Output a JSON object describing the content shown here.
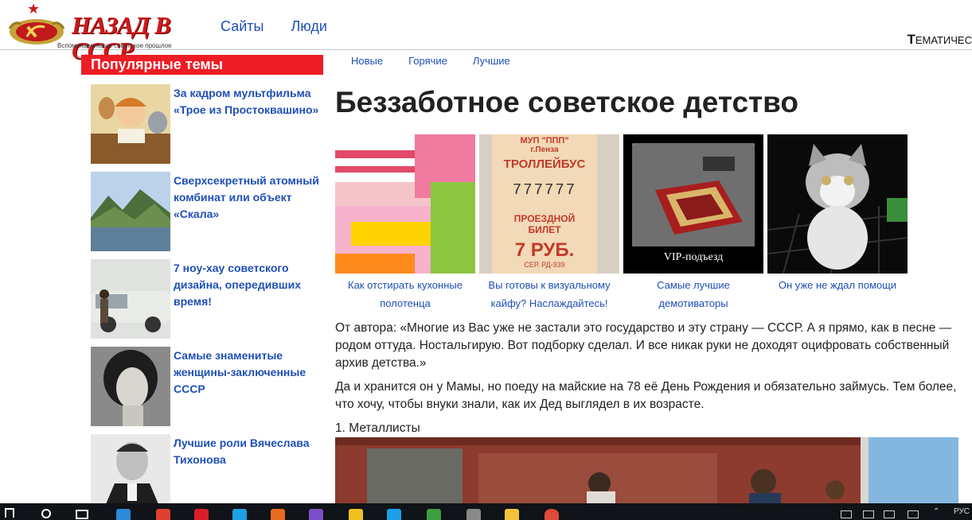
{
  "header": {
    "logo_title": "НАЗАД В СССР",
    "logo_subtitle": "Вспоминаем наше советское прошлое",
    "nav": [
      "Сайты",
      "Люди"
    ],
    "thematic_first": "Т",
    "thematic_rest": "ЕМАТИЧЕС"
  },
  "sidebar": {
    "heading": "Популярные темы",
    "items": [
      {
        "title": "За кадром мультфильма «Трое из Простоквашино»"
      },
      {
        "title": "Сверхсекретный атомный комбинат или объект «Скала»"
      },
      {
        "title": "7 ноу-хау советского дизайна, опередивших время!"
      },
      {
        "title": "Самые знаменитые женщины-заключенные СССР"
      },
      {
        "title": "Лучшие роли Вячеслава Тихонова"
      }
    ]
  },
  "subnav": [
    "Новые",
    "Горячие",
    "Лучшие"
  ],
  "article": {
    "title": "Беззаботное советское детство",
    "gallery": [
      {
        "caption": "Как отстирать кухонные полотенца"
      },
      {
        "caption": "Вы готовы к визуальному кайфу? Наслаждайтесь!",
        "ticket_org": "МУП \"ППП\"",
        "ticket_city": "г.Пенза",
        "ticket_type": "ТРОЛЛЕЙБУС",
        "ticket_number": "777777",
        "ticket_label1": "ПРОЕЗДНОЙ",
        "ticket_label2": "БИЛЕТ",
        "ticket_price": "7 РУБ.",
        "ticket_series": "СЕР. РД-939"
      },
      {
        "caption": "Самые лучшие демотиваторы",
        "image_label": "VIP-подъезд"
      },
      {
        "caption": "Он уже не ждал помощи"
      }
    ],
    "paragraphs": [
      "От автора: «Многие из Вас уже не застали это государство и эту страну — СССР. А я прямо, как в песне — родом оттуда. Ностальгирую. Вот подборку сделал. И все никак руки не доходят оцифровать собственный архив детства.»",
      "Да и хранится он у Мамы, но поеду на майские на 78 её День Рождения и обязательно займусь. Тем более, что хочу, чтобы внуки знали, как их Дед выглядел в их возрасте."
    ],
    "list_item": "1. Металлисты"
  },
  "taskbar": {
    "lang": "РУС"
  }
}
